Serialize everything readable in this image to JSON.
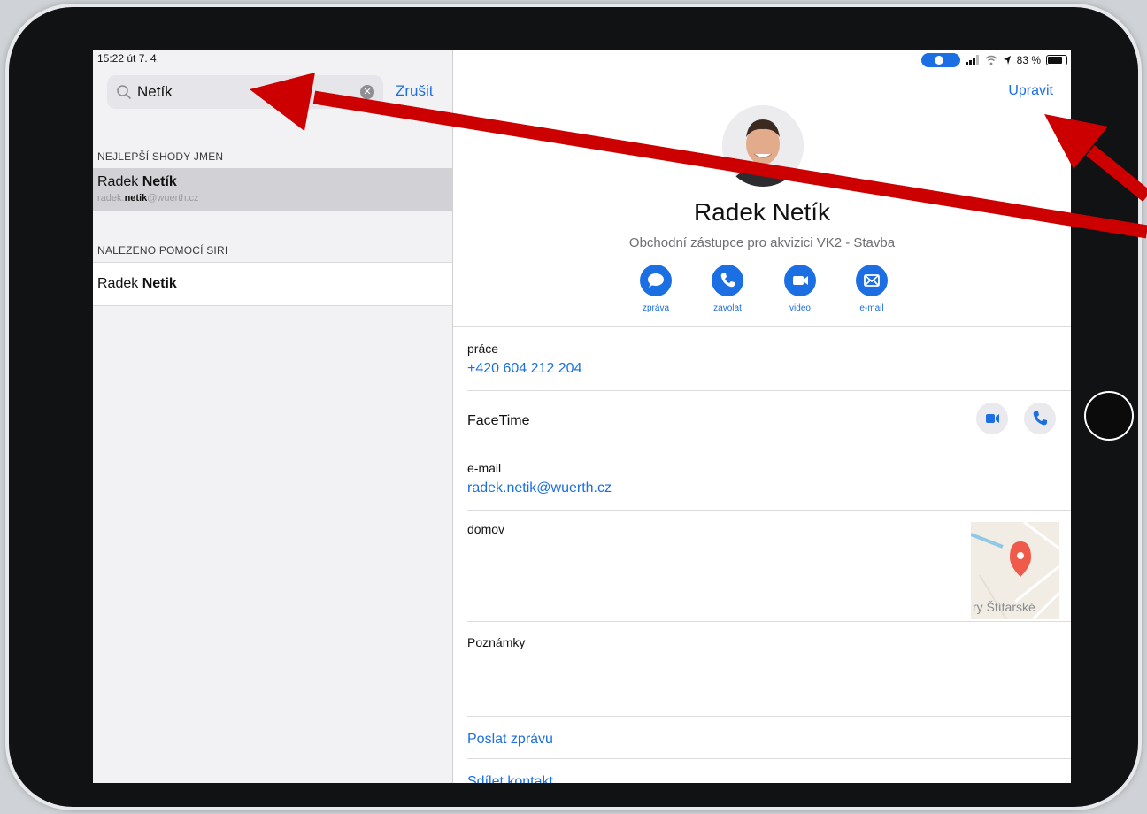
{
  "status_bar": {
    "time_date": "15:22  út 7. 4.",
    "battery": "83 %"
  },
  "search": {
    "query": "Netík",
    "cancel_label": "Zrušit"
  },
  "results": {
    "section_best": "NEJLEPŠÍ SHODY JMEN",
    "best_first": "Radek ",
    "best_last": "Netík",
    "best_email_prefix": "radek.",
    "best_email_bold": "netik",
    "best_email_suffix": "@wuerth.cz",
    "section_siri": "NALEZENO POMOCÍ SIRI",
    "siri_first": "Radek ",
    "siri_last": "Netik"
  },
  "contact": {
    "edit_label": "Upravit",
    "name": "Radek Netík",
    "title": "Obchodní zástupce pro akvizici VK2 - Stavba",
    "actions": [
      {
        "label": "zpráva",
        "icon": "message-bubble-icon"
      },
      {
        "label": "zavolat",
        "icon": "phone-icon"
      },
      {
        "label": "video",
        "icon": "video-camera-icon"
      },
      {
        "label": "e-mail",
        "icon": "envelope-icon"
      }
    ],
    "phone_label": "práce",
    "phone_value": "+420 604 212 204",
    "facetime_label": "FaceTime",
    "email_label": "e-mail",
    "email_value": "radek.netik@wuerth.cz",
    "home_label": "domov",
    "map_text": "ry Štítarské",
    "notes_label": "Poznámky",
    "send_message": "Poslat zprávu",
    "share_contact": "Sdílet kontakt"
  },
  "colors": {
    "accent": "#1b6fe3",
    "annotation_arrow": "#cc0000"
  }
}
